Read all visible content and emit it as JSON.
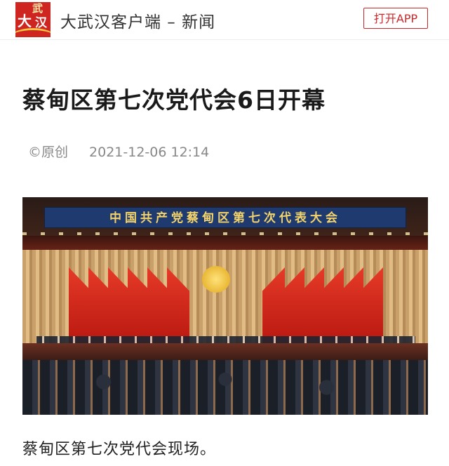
{
  "header": {
    "logo_chars": [
      "大",
      "武",
      "汉"
    ],
    "app_name": "大武汉客户端 – 新闻",
    "open_app_label": "打开APP"
  },
  "article": {
    "title": "蔡甸区第七次党代会6日开幕",
    "source": "©原创",
    "timestamp": "2021-12-06 12:14",
    "photo": {
      "banner_text": "中国共产党蔡甸区第七次代表大会",
      "caption": "蔡甸区第七次党代会现场。"
    }
  },
  "colors": {
    "accent_red": "#d0262a",
    "logo_red": "#cf2521",
    "banner_blue": "#1f3a6e",
    "title_text": "#1a1a1a",
    "meta_text": "#888888"
  }
}
